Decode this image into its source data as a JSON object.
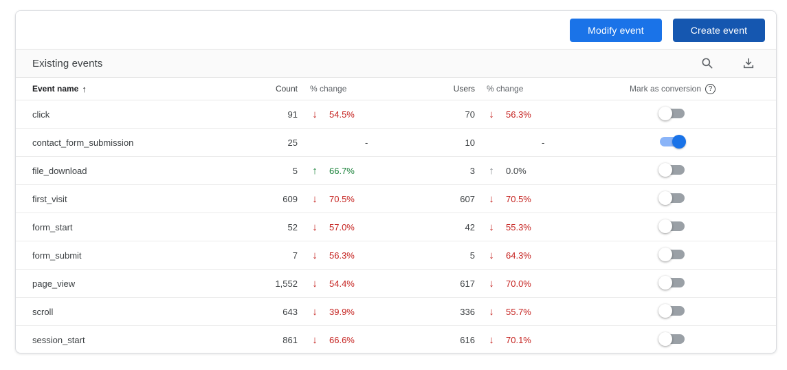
{
  "toolbar": {
    "modify_label": "Modify event",
    "create_label": "Create event"
  },
  "panel": {
    "title": "Existing events",
    "icons": [
      "search-icon",
      "download-icon"
    ]
  },
  "table": {
    "headers": {
      "event_name": "Event name",
      "count": "Count",
      "count_change": "% change",
      "users": "Users",
      "users_change": "% change",
      "conversion": "Mark as conversion"
    },
    "sort": {
      "column": "Event name",
      "direction": "ascending"
    },
    "rows": [
      {
        "name": "click",
        "count": "91",
        "count_change": {
          "dir": "down",
          "value": "54.5%",
          "tone": "neg"
        },
        "users": "70",
        "users_change": {
          "dir": "down",
          "value": "56.3%",
          "tone": "neg"
        },
        "conversion": false
      },
      {
        "name": "contact_form_submission",
        "count": "25",
        "count_change": {
          "dir": "none",
          "value": "-",
          "tone": "neutral"
        },
        "users": "10",
        "users_change": {
          "dir": "none",
          "value": "-",
          "tone": "neutral"
        },
        "conversion": true
      },
      {
        "name": "file_download",
        "count": "5",
        "count_change": {
          "dir": "up",
          "value": "66.7%",
          "tone": "pos"
        },
        "users": "3",
        "users_change": {
          "dir": "up",
          "value": "0.0%",
          "tone": "neutral"
        },
        "conversion": false
      },
      {
        "name": "first_visit",
        "count": "609",
        "count_change": {
          "dir": "down",
          "value": "70.5%",
          "tone": "neg"
        },
        "users": "607",
        "users_change": {
          "dir": "down",
          "value": "70.5%",
          "tone": "neg"
        },
        "conversion": false
      },
      {
        "name": "form_start",
        "count": "52",
        "count_change": {
          "dir": "down",
          "value": "57.0%",
          "tone": "neg"
        },
        "users": "42",
        "users_change": {
          "dir": "down",
          "value": "55.3%",
          "tone": "neg"
        },
        "conversion": false
      },
      {
        "name": "form_submit",
        "count": "7",
        "count_change": {
          "dir": "down",
          "value": "56.3%",
          "tone": "neg"
        },
        "users": "5",
        "users_change": {
          "dir": "down",
          "value": "64.3%",
          "tone": "neg"
        },
        "conversion": false
      },
      {
        "name": "page_view",
        "count": "1,552",
        "count_change": {
          "dir": "down",
          "value": "54.4%",
          "tone": "neg"
        },
        "users": "617",
        "users_change": {
          "dir": "down",
          "value": "70.0%",
          "tone": "neg"
        },
        "conversion": false
      },
      {
        "name": "scroll",
        "count": "643",
        "count_change": {
          "dir": "down",
          "value": "39.9%",
          "tone": "neg"
        },
        "users": "336",
        "users_change": {
          "dir": "down",
          "value": "55.7%",
          "tone": "neg"
        },
        "conversion": false
      },
      {
        "name": "session_start",
        "count": "861",
        "count_change": {
          "dir": "down",
          "value": "66.6%",
          "tone": "neg"
        },
        "users": "616",
        "users_change": {
          "dir": "down",
          "value": "70.1%",
          "tone": "neg"
        },
        "conversion": false
      }
    ]
  },
  "glyphs": {
    "down": "↓",
    "up": "↑",
    "sort_asc": "↑",
    "help": "?"
  },
  "colors": {
    "accent_blue": "#1a73e8",
    "dark_blue": "#1557b0",
    "negative_red": "#c5221f",
    "positive_green": "#188038",
    "neutral_gray": "#80868b",
    "toggle_on_track": "#8ab4f8",
    "toggle_on_thumb": "#1a73e8",
    "toggle_off_track": "#9aa0a6"
  }
}
